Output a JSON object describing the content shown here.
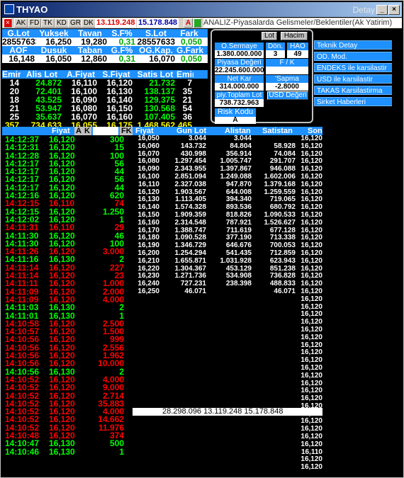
{
  "title": {
    "symbol": "THYAO",
    "right": "Detay"
  },
  "toolbar": {
    "buttons": [
      "AK",
      "FD",
      "TK",
      "KD",
      "GR",
      "DK"
    ],
    "val1": "13.119.248",
    "val2": "15.178.848",
    "a": "A",
    "news": "ANALIZ-Piyasalarda Gelismeler/Beklentiler(Ak Yatirim)"
  },
  "summary": {
    "h1": [
      "G.Lot",
      "Yuksek",
      "Tavan",
      "S.F%",
      "S.Lot",
      "Fark"
    ],
    "v1": [
      "28557633",
      "16,250",
      "19,280",
      "0,31",
      "28557633",
      "0,050"
    ],
    "h2": [
      "AOF",
      "Dusuk",
      "Taban",
      "G.F%",
      "OG.Kap.",
      "G.Fark"
    ],
    "v2": [
      "16,148",
      "16,050",
      "12,860",
      "0,31",
      "16,070",
      "0,050"
    ]
  },
  "orderbook": {
    "headers": [
      "Emir",
      "Alis Lot",
      "A.Fiyat",
      "S.Fiyat",
      "Satis Lot",
      "Emir"
    ],
    "rows": [
      [
        "14",
        "24.872",
        "16,110",
        "16,120",
        "21.732",
        "7"
      ],
      [
        "20",
        "72.401",
        "16,100",
        "16,130",
        "138.137",
        "35"
      ],
      [
        "18",
        "43.525",
        "16,090",
        "16,140",
        "129.375",
        "21"
      ],
      [
        "21",
        "53.947",
        "16,080",
        "16,150",
        "130.568",
        "54"
      ],
      [
        "25",
        "35.637",
        "16,070",
        "16,160",
        "107.405",
        "36"
      ]
    ],
    "total": [
      "357",
      "734.633",
      "16,055",
      "16,175",
      "1.468.562",
      "465"
    ]
  },
  "panel": {
    "lot": "Lot",
    "hacim": "Hacim",
    "osermaye_l": "O.Sermaye",
    "osermaye_v": "1.380.000.000",
    "don_l": "Dön.",
    "don_v": "3",
    "hao_l": "HAO",
    "hao_v": "49",
    "pd_l": "Piyasa Değeri",
    "pd_v": "22.245.600.000",
    "fk_l": "F / K",
    "fk_v": "",
    "nk_l": "Net Kar",
    "nk_v": "314.000.000",
    "sapma_l": "'Sapma",
    "sapma_v": "-2.8000",
    "ptl_l": "piy.Toplam Lot",
    "ptl_v": "738.732.963",
    "usd": "USD Değeri",
    "risk_l": "Risk Kodu",
    "risk_v": "A"
  },
  "menu": [
    "Teknik Detay",
    "OD. Mod.",
    "ENDEKS ile karsilastir",
    "USD ile karsilastir",
    "TAKAS Karsilastirma",
    "Sirket Haberleri"
  ],
  "ticks": {
    "header": [
      "Fiyat",
      "A",
      "K",
      "FK"
    ],
    "rows": [
      [
        "14:12:37",
        "16,120",
        "300",
        "g"
      ],
      [
        "14:12:31",
        "16,120",
        "15",
        "g"
      ],
      [
        "14:12:28",
        "16,120",
        "100",
        "g"
      ],
      [
        "14:12:17",
        "16,120",
        "56",
        "g"
      ],
      [
        "14:12:17",
        "16,120",
        "44",
        "g"
      ],
      [
        "14:12:17",
        "16,120",
        "56",
        "g"
      ],
      [
        "14:12:17",
        "16,120",
        "44",
        "g"
      ],
      [
        "14:12:16",
        "16,120",
        "620",
        "g"
      ],
      [
        "14:12:15",
        "16,110",
        "74",
        "r"
      ],
      [
        "14:12:15",
        "16,120",
        "1.250",
        "g"
      ],
      [
        "14:12:02",
        "16,120",
        "1",
        "g"
      ],
      [
        "14:11:31",
        "16,110",
        "29",
        "r"
      ],
      [
        "14:11:30",
        "16,120",
        "46",
        "g"
      ],
      [
        "14:11:30",
        "16,120",
        "100",
        "g"
      ],
      [
        "14:11:26",
        "16,120",
        "3.000",
        "r"
      ],
      [
        "14:11:16",
        "16,130",
        "2",
        "g"
      ],
      [
        "14:11:14",
        "16,120",
        "227",
        "r"
      ],
      [
        "14:11:14",
        "16,120",
        "23",
        "r"
      ],
      [
        "14:11:11",
        "16,120",
        "1.000",
        "r"
      ],
      [
        "14:11:09",
        "16,120",
        "2.000",
        "r"
      ],
      [
        "14:11:09",
        "16,120",
        "4.000",
        "r"
      ],
      [
        "14:11:03",
        "16,130",
        "2",
        "g"
      ],
      [
        "14:11:01",
        "16,130",
        "1",
        "g"
      ],
      [
        "14:10:58",
        "16,120",
        "2.500",
        "r"
      ],
      [
        "14:10:57",
        "16,120",
        "1.500",
        "r"
      ],
      [
        "14:10:56",
        "16,120",
        "999",
        "r"
      ],
      [
        "14:10:56",
        "16,120",
        "2.556",
        "r"
      ],
      [
        "14:10:56",
        "16,120",
        "1.962",
        "r"
      ],
      [
        "14:10:56",
        "16,120",
        "10.000",
        "r"
      ],
      [
        "14:10:56",
        "16,130",
        "2",
        "g"
      ],
      [
        "14:10:52",
        "16,120",
        "4.000",
        "r"
      ],
      [
        "14:10:52",
        "16,120",
        "9.000",
        "r"
      ],
      [
        "14:10:52",
        "16,120",
        "2.714",
        "r"
      ],
      [
        "14:10:52",
        "16,120",
        "35.883",
        "r"
      ],
      [
        "14:10:52",
        "16,120",
        "4.000",
        "r"
      ],
      [
        "14:10:52",
        "16,120",
        "14.662",
        "r"
      ],
      [
        "14:10:52",
        "16,120",
        "11.976",
        "r"
      ],
      [
        "14:10:48",
        "16,120",
        "374",
        "r"
      ],
      [
        "14:10:47",
        "16,130",
        "500",
        "g"
      ],
      [
        "14:10:46",
        "16,130",
        "1",
        "g"
      ]
    ]
  },
  "depth": {
    "headers": [
      "Fiyat",
      "Gun Lot",
      "Alistan",
      "Satistan",
      "Son"
    ],
    "rows": [
      [
        "16,050",
        "3.044",
        "3.044",
        "",
        "16,120"
      ],
      [
        "16,060",
        "143.732",
        "84.804",
        "58.928",
        "16,120"
      ],
      [
        "16,070",
        "430.998",
        "356.914",
        "74.084",
        "16,120"
      ],
      [
        "16,080",
        "1.297.454",
        "1.005.747",
        "291.707",
        "16,120"
      ],
      [
        "16,090",
        "2.343.955",
        "1.397.867",
        "946.088",
        "16,120"
      ],
      [
        "16,100",
        "2.851.094",
        "1.249.088",
        "1.602.006",
        "16,120"
      ],
      [
        "16,110",
        "2.327.038",
        "947.870",
        "1.379.168",
        "16,120"
      ],
      [
        "16,120",
        "1.903.567",
        "644.008",
        "1.259.559",
        "16,120"
      ],
      [
        "16,130",
        "1.113.405",
        "394.340",
        "719.065",
        "16,120"
      ],
      [
        "16,140",
        "1.574.328",
        "893.536",
        "680.792",
        "16,120"
      ],
      [
        "16,150",
        "1.909.359",
        "818.826",
        "1.090.533",
        "16,120"
      ],
      [
        "16,160",
        "2.314.548",
        "787.921",
        "1.526.627",
        "16,120"
      ],
      [
        "16,170",
        "1.388.747",
        "711.619",
        "677.128",
        "16,120"
      ],
      [
        "16,180",
        "1.090.528",
        "377.190",
        "713.338",
        "16,120"
      ],
      [
        "16,190",
        "1.346.729",
        "646.676",
        "700.053",
        "16,120"
      ],
      [
        "16,200",
        "1.254.294",
        "541.435",
        "712.859",
        "16,120"
      ],
      [
        "16,210",
        "1.655.871",
        "1.031.928",
        "623.943",
        "16,120"
      ],
      [
        "16,220",
        "1.304.367",
        "453.129",
        "851.238",
        "16,120"
      ],
      [
        "16,230",
        "1.271.736",
        "534.908",
        "736.828",
        "16,120"
      ],
      [
        "16,240",
        "727.231",
        "238.398",
        "488.833",
        "16,120"
      ],
      [
        "16,250",
        "46.071",
        "",
        "46.071",
        "16,120"
      ]
    ],
    "son_extra": [
      "16,120",
      "16,120",
      "16,120",
      "16,120",
      "16,120",
      "16,120",
      "16,120",
      "16,120",
      "16,120",
      "16,120",
      "16,120",
      "16,120",
      "16,120",
      "16,120",
      "16,120",
      "16,120",
      "16,120",
      "16,120",
      "16,120",
      "16,120",
      "16,110",
      "16,120",
      "16,120"
    ],
    "total": "28.298.096 13.119.248 15.178.848"
  }
}
